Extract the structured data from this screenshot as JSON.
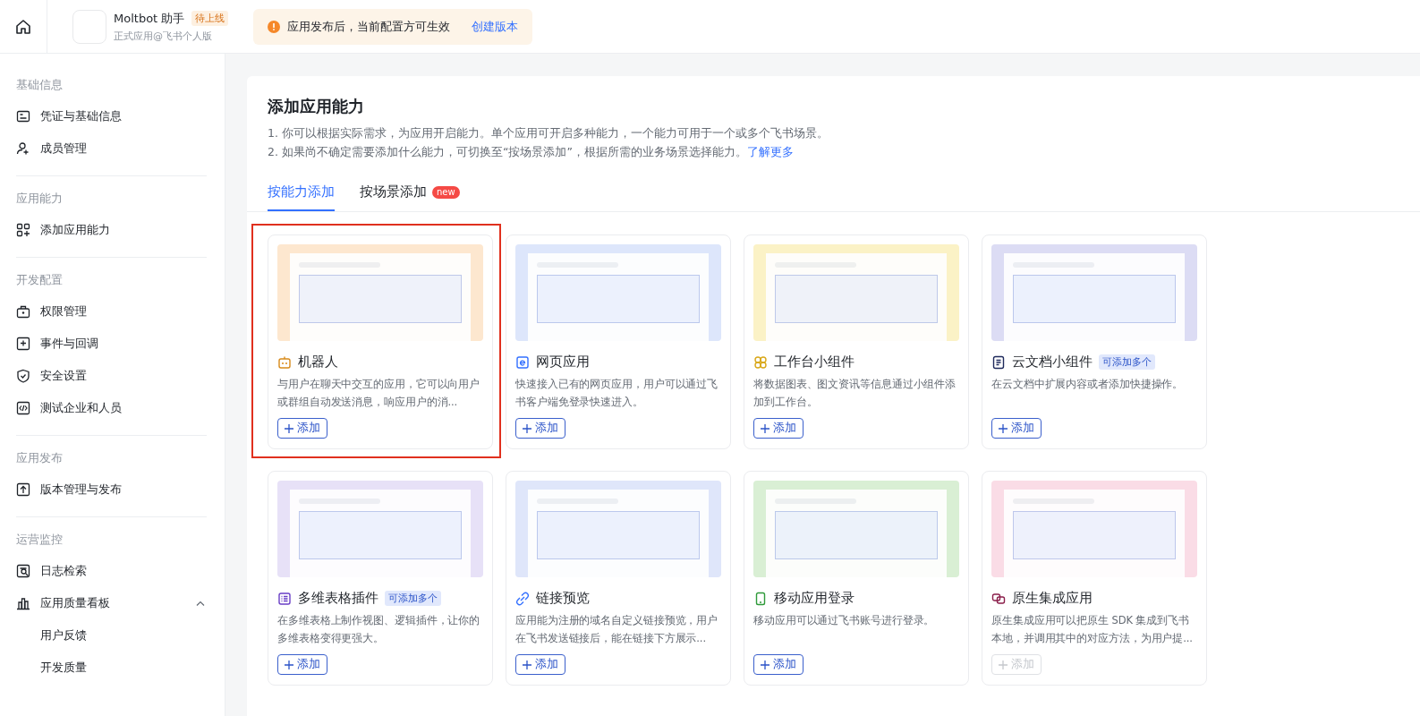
{
  "header": {
    "app_name": "Moltbot 助手",
    "status_badge": "待上线",
    "app_subtitle": "正式应用@飞书个人版",
    "notice": {
      "text": "应用发布后，当前配置方可生效",
      "link": "创建版本"
    }
  },
  "sidebar": {
    "sections": [
      {
        "heading": "基础信息",
        "items": [
          {
            "kind": "idcard",
            "label": "凭证与基础信息"
          },
          {
            "kind": "member",
            "label": "成员管理"
          }
        ]
      },
      {
        "heading": "应用能力",
        "items": [
          {
            "kind": "grid",
            "label": "添加应用能力"
          }
        ]
      },
      {
        "heading": "开发配置",
        "items": [
          {
            "kind": "lock",
            "label": "权限管理"
          },
          {
            "kind": "event",
            "label": "事件与回调"
          },
          {
            "kind": "shield",
            "label": "安全设置"
          },
          {
            "kind": "code",
            "label": "测试企业和人员"
          }
        ]
      },
      {
        "heading": "应用发布",
        "items": [
          {
            "kind": "upload",
            "label": "版本管理与发布"
          }
        ]
      },
      {
        "heading": "运营监控",
        "items": [
          {
            "kind": "log",
            "label": "日志检索"
          },
          {
            "kind": "chart",
            "label": "应用质量看板",
            "expanded": true,
            "children": [
              {
                "label": "用户反馈"
              },
              {
                "label": "开发质量"
              }
            ]
          }
        ]
      }
    ]
  },
  "main": {
    "title": "添加应用能力",
    "notes": [
      "1. 你可以根据实际需求，为应用开启能力。单个应用可开启多种能力，一个能力可用于一个或多个飞书场景。",
      "2. 如果尚不确定需要添加什么能力，可切换至“按场景添加”，根据所需的业务场景选择能力。"
    ],
    "notes_link": "了解更多",
    "tabs": [
      {
        "label": "按能力添加",
        "selected": true
      },
      {
        "label": "按场景添加",
        "selected": false,
        "badge": "new"
      }
    ],
    "cards": [
      {
        "kind": "robot",
        "title": "机器人",
        "description": "与用户在聊天中交互的应用，它可以向用户或群组自动发送消息，响应用户的消...",
        "button": "添加",
        "disabled": false,
        "highlighted": true
      },
      {
        "kind": "web",
        "title": "网页应用",
        "description": "快速接入已有的网页应用，用户可以通过飞书客户端免登录快速进入。",
        "button": "添加",
        "disabled": false,
        "highlighted": false
      },
      {
        "kind": "widget",
        "title": "工作台小组件",
        "description": "将数据图表、图文资讯等信息通过小组件添加到工作台。",
        "button": "添加",
        "disabled": false,
        "highlighted": false
      },
      {
        "kind": "doc",
        "title": "云文档小组件",
        "tag": "可添加多个",
        "description": "在云文档中扩展内容或者添加快捷操作。",
        "button": "添加",
        "disabled": false,
        "highlighted": false
      },
      {
        "kind": "base",
        "title": "多维表格插件",
        "tag": "可添加多个",
        "description": "在多维表格上制作视图、逻辑插件，让你的多维表格变得更强大。",
        "button": "添加",
        "disabled": false,
        "highlighted": false
      },
      {
        "kind": "link",
        "title": "链接预览",
        "description": "应用能为注册的域名自定义链接预览，用户在飞书发送链接后，能在链接下方展示...",
        "button": "添加",
        "disabled": false,
        "highlighted": false
      },
      {
        "kind": "mobile",
        "title": "移动应用登录",
        "description": "移动应用可以通过飞书账号进行登录。",
        "button": "添加",
        "disabled": false,
        "highlighted": false
      },
      {
        "kind": "native",
        "title": "原生集成应用",
        "description": "原生集成应用可以把原生 SDK 集成到飞书本地，并调用其中的对应方法，为用户提...",
        "button": "添加",
        "disabled": true,
        "highlighted": false
      }
    ]
  }
}
